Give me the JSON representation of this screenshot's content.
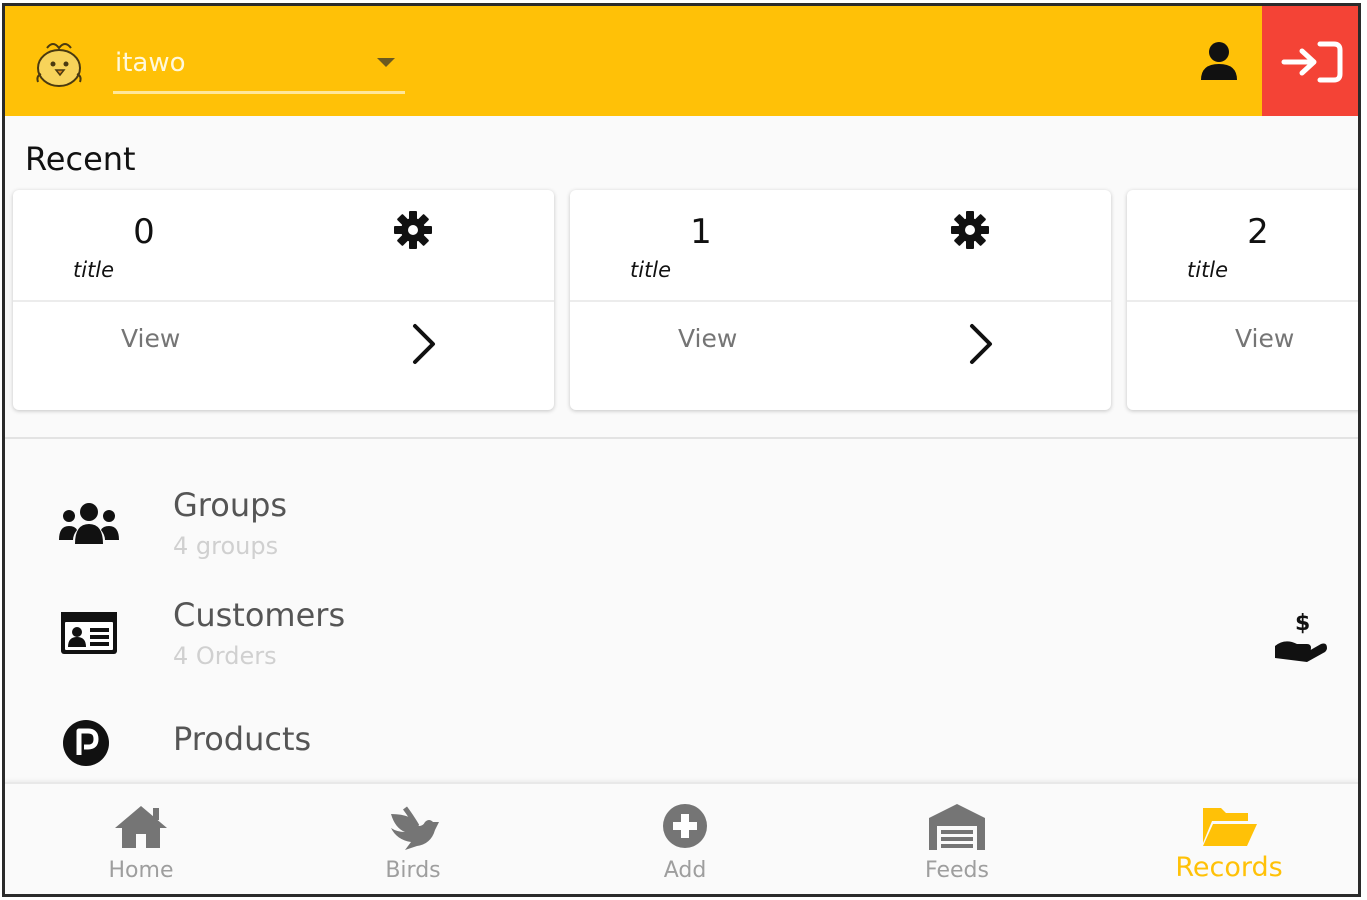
{
  "appbar": {
    "account": {
      "value": "itawo"
    },
    "colors": {
      "bar": "#ffc107",
      "logout": "#f44336"
    },
    "icons": {
      "logo": "chick-logo-icon",
      "profile": "person-icon",
      "logout": "sign-in-icon",
      "dropdown": "caret-down-icon"
    }
  },
  "recent": {
    "heading": "Recent",
    "cards": [
      {
        "number": "0",
        "subtitle": "title",
        "view_label": "View"
      },
      {
        "number": "1",
        "subtitle": "title",
        "view_label": "View"
      },
      {
        "number": "2",
        "subtitle": "title",
        "view_label": "View"
      }
    ]
  },
  "menu": [
    {
      "title": "Groups",
      "subtitle": "4 groups",
      "icon": "users-icon"
    },
    {
      "title": "Customers",
      "subtitle": "4 Orders",
      "icon": "id-card-icon",
      "trailing_icon": "hand-holding-dollar-icon"
    },
    {
      "title": "Products",
      "icon": "parking-circle-icon"
    }
  ],
  "bottom_nav": {
    "active": "Records",
    "active_color": "#ffc107",
    "items": [
      {
        "label": "Home",
        "icon": "home-icon"
      },
      {
        "label": "Birds",
        "icon": "dove-icon"
      },
      {
        "label": "Add",
        "icon": "plus-circle-icon"
      },
      {
        "label": "Feeds",
        "icon": "warehouse-icon"
      },
      {
        "label": "Records",
        "icon": "folder-open-icon"
      }
    ]
  }
}
